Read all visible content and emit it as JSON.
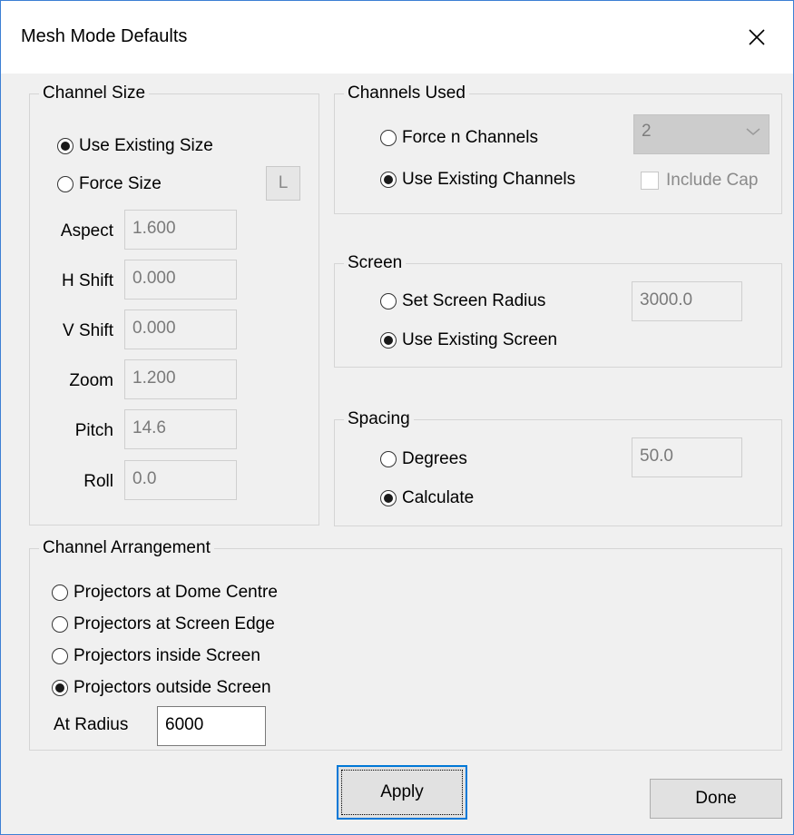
{
  "window": {
    "title": "Mesh Mode Defaults"
  },
  "channel_size": {
    "legend": "Channel Size",
    "use_existing": "Use Existing Size",
    "force_size": "Force Size",
    "l_button": "L",
    "fields": {
      "aspect": {
        "label": "Aspect",
        "value": "1.600"
      },
      "h_shift": {
        "label": "H Shift",
        "value": "0.000"
      },
      "v_shift": {
        "label": "V Shift",
        "value": "0.000"
      },
      "zoom": {
        "label": "Zoom",
        "value": "1.200"
      },
      "pitch": {
        "label": "Pitch",
        "value": "14.6"
      },
      "roll": {
        "label": "Roll",
        "value": "0.0"
      }
    }
  },
  "channels_used": {
    "legend": "Channels Used",
    "force_n": "Force n Channels",
    "use_existing": "Use Existing Channels",
    "count_value": "2",
    "include_cap": "Include Cap"
  },
  "screen": {
    "legend": "Screen",
    "set_radius": "Set Screen Radius",
    "use_existing": "Use Existing Screen",
    "radius_value": "3000.0"
  },
  "spacing": {
    "legend": "Spacing",
    "degrees": "Degrees",
    "calculate": "Calculate",
    "degrees_value": "50.0"
  },
  "arrangement": {
    "legend": "Channel Arrangement",
    "options": [
      "Projectors at Dome Centre",
      "Projectors at Screen Edge",
      "Projectors inside Screen",
      "Projectors outside Screen"
    ],
    "at_radius_label": "At Radius",
    "at_radius_value": "6000"
  },
  "buttons": {
    "apply": "Apply",
    "done": "Done"
  },
  "icons": {
    "close": "close-icon",
    "dropdown": "chevron-down-icon"
  },
  "colors": {
    "window_border": "#3c7fd4",
    "dialog_bg": "#f0f0f0",
    "focus": "#0078d7"
  }
}
